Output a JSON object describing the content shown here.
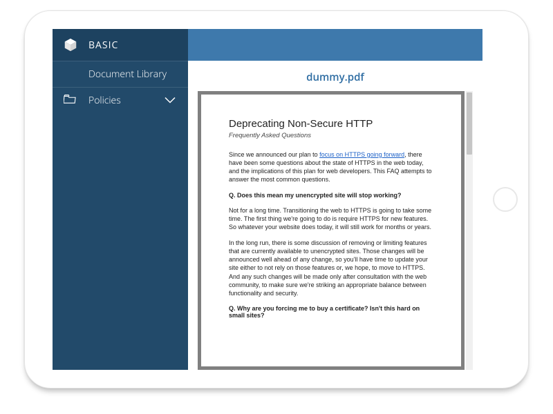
{
  "sidebar": {
    "brand": "BASIC",
    "items": [
      {
        "label": "Document Library"
      },
      {
        "label": "Policies"
      }
    ]
  },
  "document": {
    "filename": "dummy.pdf"
  },
  "pdf": {
    "title": "Deprecating Non-Secure HTTP",
    "subtitle": "Frequently Asked Questions",
    "intro_pre": "Since we announced our plan to ",
    "intro_link": "focus on HTTPS going forward",
    "intro_post": ", there have been some questions about the state of HTTPS in the web today, and the implications of this plan for web developers.  This FAQ attempts to answer the most common questions.",
    "q1": "Q. Does this mean my unencrypted site will stop working?",
    "a1a": "Not for a long time.  Transitioning the web to HTTPS is going to take some time.  The first thing we're going to do is require HTTPS for new features.  So whatever your website does today, it will still work for months or years.",
    "a1b": "In the long run, there is some discussion of removing or limiting features that are currently available to unencrypted sites.  Those changes will be announced well ahead of any change, so you'll have time to update your site either to not rely on those features or, we hope, to move to HTTPS.  And any such changes will be made only after consultation with the web community, to make sure we're striking an appropriate balance between functionality and security.",
    "q2": "Q. Why are you forcing me to buy a certificate?  Isn't this hard on small sites?"
  }
}
